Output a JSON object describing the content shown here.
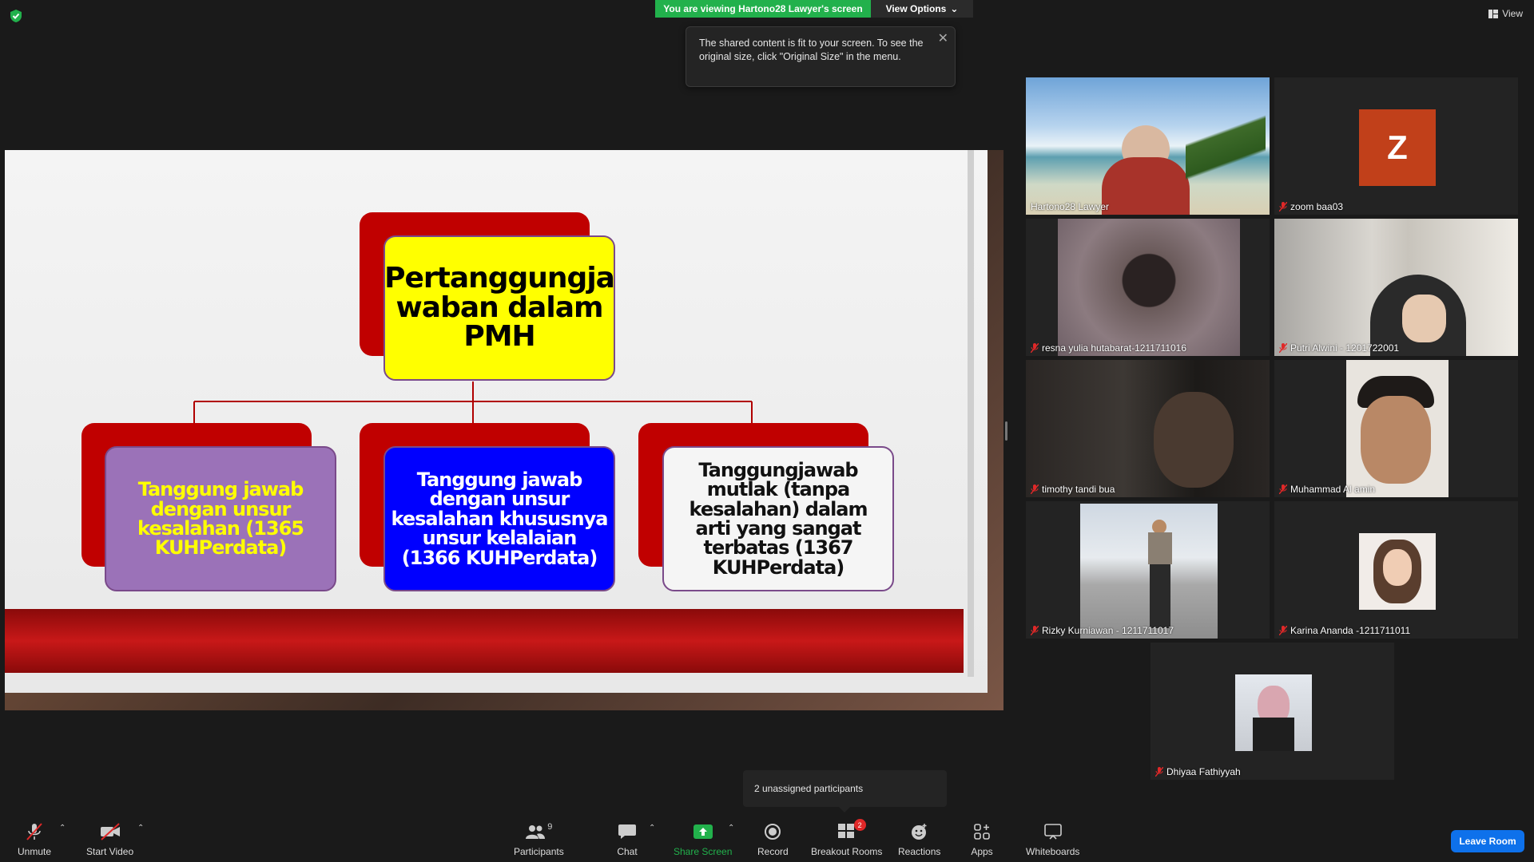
{
  "banner": {
    "viewing_text": "You are viewing Hartono28 Lawyer's screen",
    "view_options_label": "View Options"
  },
  "tooltip": {
    "text": "The shared content is fit to your screen. To see the original size, click \"Original Size\" in the menu.",
    "close_icon": "close-icon"
  },
  "top_right": {
    "view_label": "View"
  },
  "slide": {
    "top_box": "Pertanggungja waban dalam PMH",
    "box_left": "Tanggung jawab dengan unsur kesalahan (1365 KUHPerdata)",
    "box_middle": "Tanggung jawab dengan unsur kesalahan khususnya unsur kelalaian (1366 KUHPerdata)",
    "box_right": "Tanggungjawab mutlak (tanpa kesalahan) dalam arti yang sangat terbatas (1367 KUHPerdata)",
    "colors": {
      "top_box": "#ffff00",
      "box_left": "#9b72b8",
      "box_middle": "#0000ff",
      "box_right": "#f5f5f5",
      "red_shadow": "#c00000",
      "text_yellow": "#ffff00"
    }
  },
  "participants": [
    {
      "name": "Hartono28 Lawyer",
      "active_speaker": true,
      "muted": false
    },
    {
      "name": "zoom baa03",
      "avatar_letter": "Z",
      "avatar_color": "#c1401a",
      "muted": true
    },
    {
      "name": "resna yulia hutabarat-1211711016",
      "muted": true
    },
    {
      "name": "Putri Alwini - 1201722001",
      "muted": true
    },
    {
      "name": "timothy tandi bua",
      "muted": true
    },
    {
      "name": "Muhammad Al amin",
      "muted": true
    },
    {
      "name": "Rizky Kurniawan - 1211711017",
      "muted": true
    },
    {
      "name": "Karina Ananda -1211711011",
      "muted": true
    },
    {
      "name": "Dhiyaa Fathiyyah",
      "muted": true
    }
  ],
  "unassigned": {
    "text": "2 unassigned participants"
  },
  "toolbar": {
    "unmute": "Unmute",
    "start_video": "Start Video",
    "participants": "Participants",
    "participants_count": "9",
    "chat": "Chat",
    "share_screen": "Share Screen",
    "record": "Record",
    "breakout_rooms": "Breakout Rooms",
    "breakout_badge": "2",
    "reactions": "Reactions",
    "apps": "Apps",
    "whiteboards": "Whiteboards",
    "leave_room": "Leave Room"
  },
  "colors": {
    "accent_green": "#22b14c",
    "leave_blue": "#0e71eb",
    "active_border": "#c6e93a",
    "mute_red": "#e02828"
  }
}
